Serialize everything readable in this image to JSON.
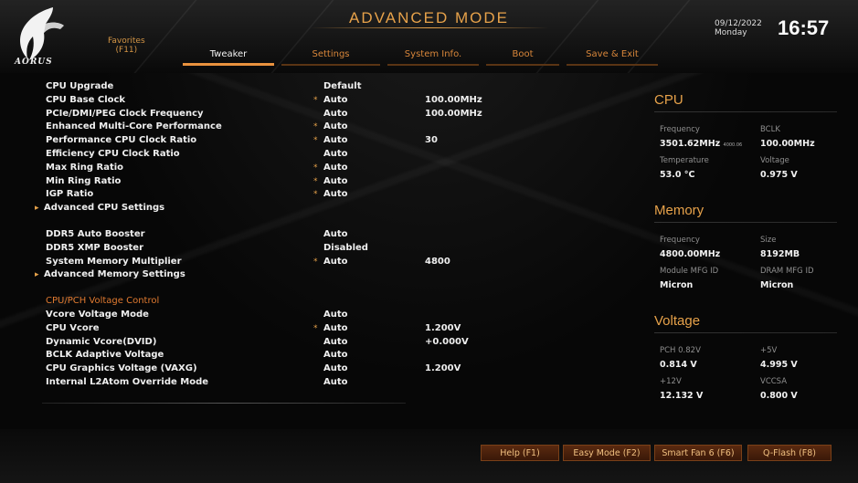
{
  "header": {
    "mode_title": "ADVANCED MODE",
    "brand": "AORUS",
    "favorites_label": "Favorites",
    "favorites_key": "(F11)",
    "date": "09/12/2022",
    "weekday": "Monday",
    "time": "16:57"
  },
  "tabs": [
    {
      "label": "Tweaker",
      "active": true
    },
    {
      "label": "Settings",
      "active": false
    },
    {
      "label": "System Info.",
      "active": false
    },
    {
      "label": "Boot",
      "active": false
    },
    {
      "label": "Save & Exit",
      "active": false
    }
  ],
  "settings": [
    {
      "label": "CPU Upgrade",
      "value": "Default",
      "value2": "",
      "star": false
    },
    {
      "label": "CPU Base Clock",
      "value": "Auto",
      "value2": "100.00MHz",
      "star": true
    },
    {
      "label": "PCIe/DMI/PEG Clock Frequency",
      "value": "Auto",
      "value2": "100.00MHz",
      "star": false
    },
    {
      "label": "Enhanced Multi-Core Performance",
      "value": "Auto",
      "value2": "",
      "star": true
    },
    {
      "label": "Performance CPU Clock Ratio",
      "value": "Auto",
      "value2": "30",
      "star": true
    },
    {
      "label": "Efficiency CPU Clock Ratio",
      "value": "Auto",
      "value2": "",
      "star": false
    },
    {
      "label": "Max Ring Ratio",
      "value": "Auto",
      "value2": "",
      "star": true
    },
    {
      "label": "Min Ring Ratio",
      "value": "Auto",
      "value2": "",
      "star": true
    },
    {
      "label": "IGP Ratio",
      "value": "Auto",
      "value2": "",
      "star": true
    },
    {
      "label": "Advanced CPU Settings",
      "submenu": true
    },
    {
      "label": "DDR5 Auto Booster",
      "value": "Auto",
      "value2": "",
      "star": false,
      "gap_before": true
    },
    {
      "label": "DDR5 XMP Booster",
      "value": "Disabled",
      "value2": "",
      "star": false
    },
    {
      "label": "System Memory Multiplier",
      "value": "Auto",
      "value2": "4800",
      "star": true
    },
    {
      "label": "Advanced Memory Settings",
      "submenu": true
    },
    {
      "label": "CPU/PCH Voltage Control",
      "section": true,
      "gap_before": true
    },
    {
      "label": "Vcore Voltage Mode",
      "value": "Auto",
      "value2": "",
      "star": false
    },
    {
      "label": "CPU Vcore",
      "value": "Auto",
      "value2": "1.200V",
      "star": true
    },
    {
      "label": "Dynamic Vcore(DVID)",
      "value": "Auto",
      "value2": "+0.000V",
      "star": false
    },
    {
      "label": "BCLK Adaptive Voltage",
      "value": "Auto",
      "value2": "",
      "star": false
    },
    {
      "label": "CPU Graphics Voltage (VAXG)",
      "value": "Auto",
      "value2": "1.200V",
      "star": false
    },
    {
      "label": "Internal L2Atom Override Mode",
      "value": "Auto",
      "value2": "",
      "star": false
    }
  ],
  "star_glyph": "*",
  "arrow_glyph": "▸",
  "panel": {
    "cpu": {
      "title": "CPU",
      "rows": [
        {
          "k1": "Frequency",
          "v1": "3501.62MHz",
          "sub1": "4000.06",
          "k2": "BCLK",
          "v2": "100.00MHz"
        },
        {
          "k1": "Temperature",
          "v1": "53.0 °C",
          "sub1": "",
          "k2": "Voltage",
          "v2": "0.975 V"
        }
      ]
    },
    "memory": {
      "title": "Memory",
      "rows": [
        {
          "k1": "Frequency",
          "v1": "4800.00MHz",
          "k2": "Size",
          "v2": "8192MB"
        },
        {
          "k1": "Module MFG ID",
          "v1": "Micron",
          "k2": "DRAM MFG ID",
          "v2": "Micron"
        }
      ]
    },
    "voltage": {
      "title": "Voltage",
      "rows": [
        {
          "k1": "PCH 0.82V",
          "v1": "0.814 V",
          "k2": "+5V",
          "v2": "4.995 V"
        },
        {
          "k1": "+12V",
          "v1": "12.132 V",
          "k2": "VCCSA",
          "v2": "0.800 V"
        }
      ]
    }
  },
  "footer": {
    "buttons": [
      {
        "label": "Help (F1)"
      },
      {
        "label": "Easy Mode (F2)"
      },
      {
        "label": "Smart Fan 6 (F6)"
      },
      {
        "label": "Q-Flash (F8)"
      }
    ]
  },
  "colors": {
    "accent": "#e7a24a",
    "tab_inactive": "#d8863a",
    "section": "#e07a30",
    "background": "#070707"
  },
  "icons": [
    "aorus-eagle-logo"
  ]
}
